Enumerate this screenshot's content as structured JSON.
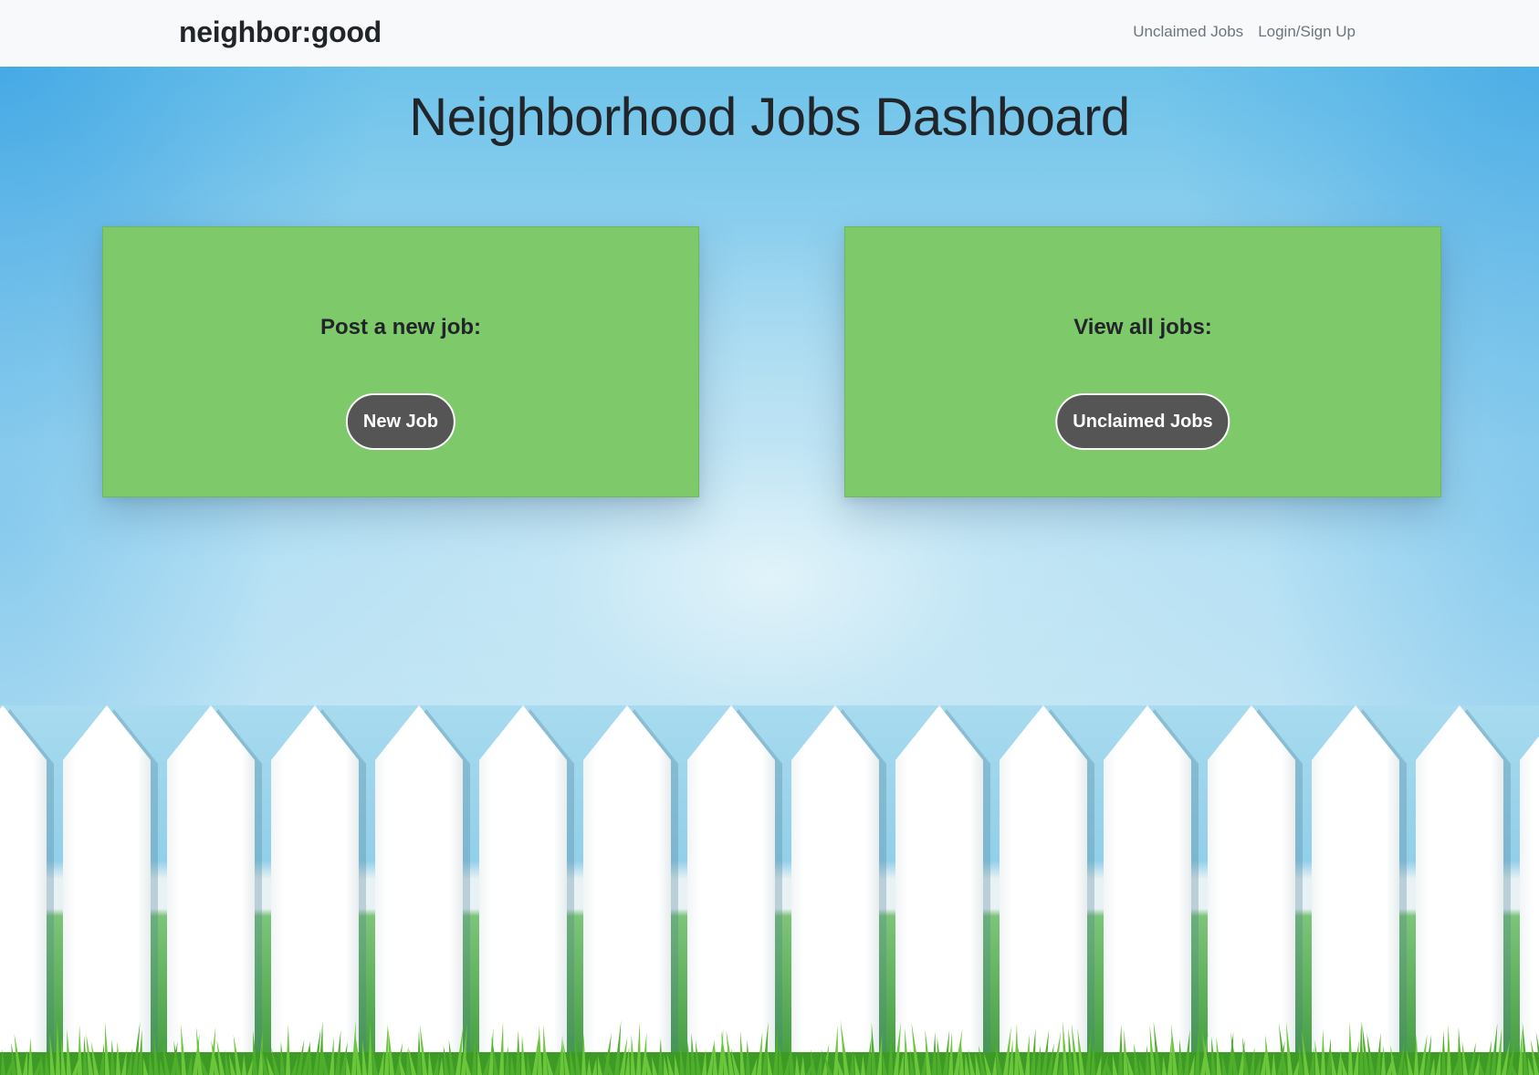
{
  "navbar": {
    "brand": "neighbor:good",
    "links": [
      "Unclaimed Jobs",
      "Login/Sign Up"
    ]
  },
  "main": {
    "title": "Neighborhood Jobs Dashboard",
    "cards": [
      {
        "heading": "Post a new job:",
        "button": "New Job"
      },
      {
        "heading": "View all jobs:",
        "button": "Unclaimed Jobs"
      }
    ]
  },
  "colors": {
    "navbar_bg": "#f8f9fa",
    "card_green": "#7eca6a",
    "button_dark": "#555555",
    "sky_blue": "#8fd0ee"
  }
}
